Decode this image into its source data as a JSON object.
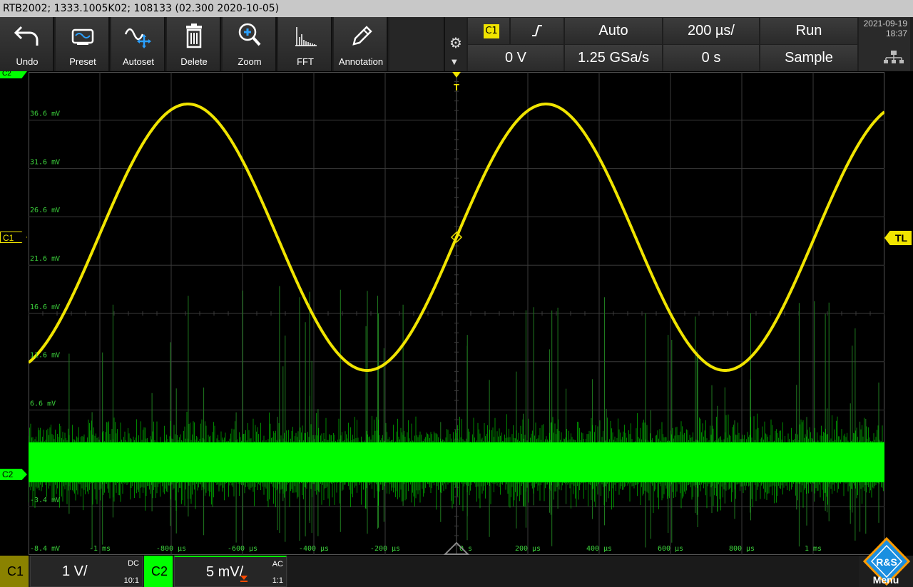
{
  "titlebar": {
    "text": "RTB2002; 1333.1005K02; 108133 (02.300 2020-10-05)"
  },
  "toolbar": {
    "buttons": [
      {
        "label": "Undo",
        "icon": "undo-arrow-icon"
      },
      {
        "label": "Preset",
        "icon": "preset-icon"
      },
      {
        "label": "Autoset",
        "icon": "autoset-icon"
      },
      {
        "label": "Delete",
        "icon": "trash-icon"
      },
      {
        "label": "Zoom",
        "icon": "zoom-icon"
      },
      {
        "label": "FFT",
        "icon": "fft-icon"
      },
      {
        "label": "Annotation",
        "icon": "pen-icon"
      }
    ],
    "settings_icon": "gear-icon"
  },
  "trigger_panel": {
    "source": "C1",
    "slope_icon": "rising-edge-icon",
    "mode": "Auto",
    "timebase": "200 µs/",
    "run_state": "Run",
    "level": "0 V",
    "sample_rate": "1.25 GSa/s",
    "position": "0 s",
    "acq_mode": "Sample"
  },
  "datetime": {
    "date": "2021-09-19",
    "time": "18:37"
  },
  "markers": {
    "c1": "C1",
    "c2": "C2",
    "c2_top": "C2",
    "trigger_level": "TL",
    "trigger_pos": "T"
  },
  "y_axis_labels": [
    "36.6 mV",
    "31.6 mV",
    "26.6 mV",
    "21.6 mV",
    "16.6 mV",
    "11.6 mV",
    "6.6 mV",
    "-3.4 mV",
    "-8.4 mV"
  ],
  "x_axis_labels": [
    "-1 ms",
    "-800 µs",
    "-600 µs",
    "-400 µs",
    "-200 µs",
    "0 s",
    "200 µs",
    "400 µs",
    "600 µs",
    "800 µs",
    "1 ms"
  ],
  "colors": {
    "ch1": "#f0e400",
    "ch2": "#00ff00",
    "grid": "#3a3a3a"
  },
  "bottom": {
    "ch1": {
      "tag": "C1",
      "scale": "1 V/",
      "coupling": "DC",
      "probe": "10:1"
    },
    "ch2": {
      "tag": "C2",
      "scale": "5 mV/",
      "coupling": "AC",
      "probe": "1:1"
    },
    "menu": "Menu",
    "logo_text": "R&S"
  }
}
